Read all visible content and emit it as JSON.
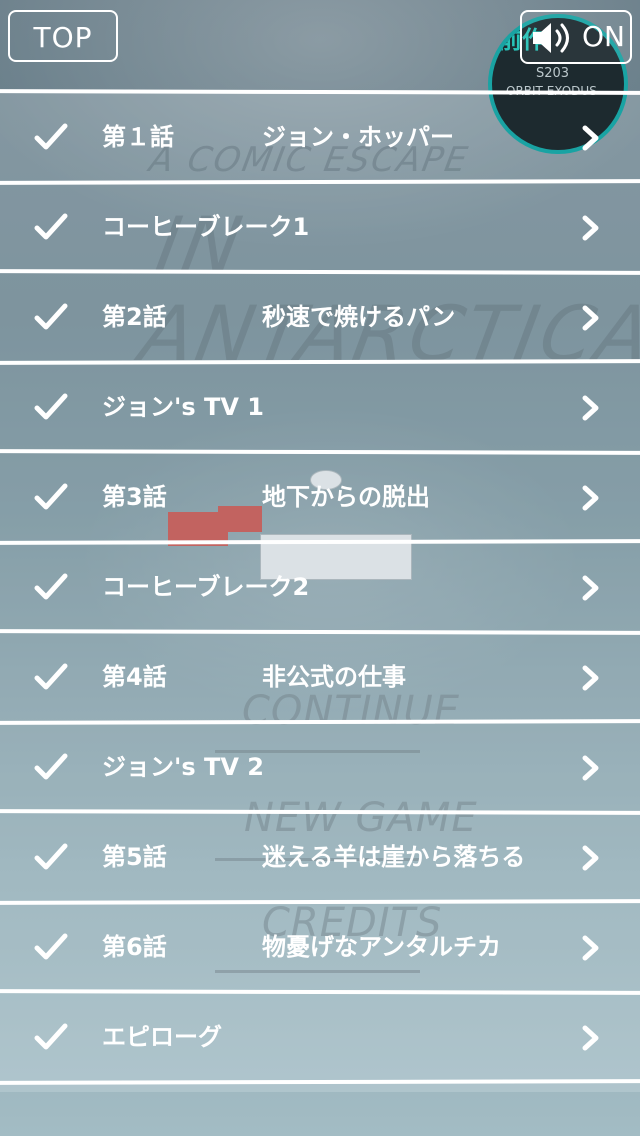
{
  "header": {
    "top_label": "TOP",
    "sound_label": "ON",
    "prev_badge": {
      "kanji": "前作",
      "line1": "S203",
      "line2": "ORBIT EXODUS"
    }
  },
  "background": {
    "title_small": "A COMIC ESCAPE",
    "title_big": "IN ANTARCTICA",
    "menu": [
      "CONTINUE",
      "NEW GAME",
      "CREDITS"
    ]
  },
  "episodes": [
    {
      "label": "第１話",
      "subtitle": "ジョン・ホッパー",
      "completed": true
    },
    {
      "label": "コーヒーブレーク1",
      "subtitle": "",
      "completed": true
    },
    {
      "label": "第2話",
      "subtitle": "秒速で焼けるパン",
      "completed": true
    },
    {
      "label": "ジョン's TV 1",
      "subtitle": "",
      "completed": true
    },
    {
      "label": "第3話",
      "subtitle": "地下からの脱出",
      "completed": true
    },
    {
      "label": "コーヒーブレーク2",
      "subtitle": "",
      "completed": true
    },
    {
      "label": "第4話",
      "subtitle": "非公式の仕事",
      "completed": true
    },
    {
      "label": "ジョン's TV 2",
      "subtitle": "",
      "completed": true
    },
    {
      "label": "第5話",
      "subtitle": "迷える羊は崖から落ちる",
      "completed": true
    },
    {
      "label": "第6話",
      "subtitle": "物憂げなアンタルチカ",
      "completed": true
    },
    {
      "label": "エピローグ",
      "subtitle": "",
      "completed": true
    }
  ],
  "colors": {
    "accent": "#19a3a3",
    "text": "#ffffff"
  }
}
